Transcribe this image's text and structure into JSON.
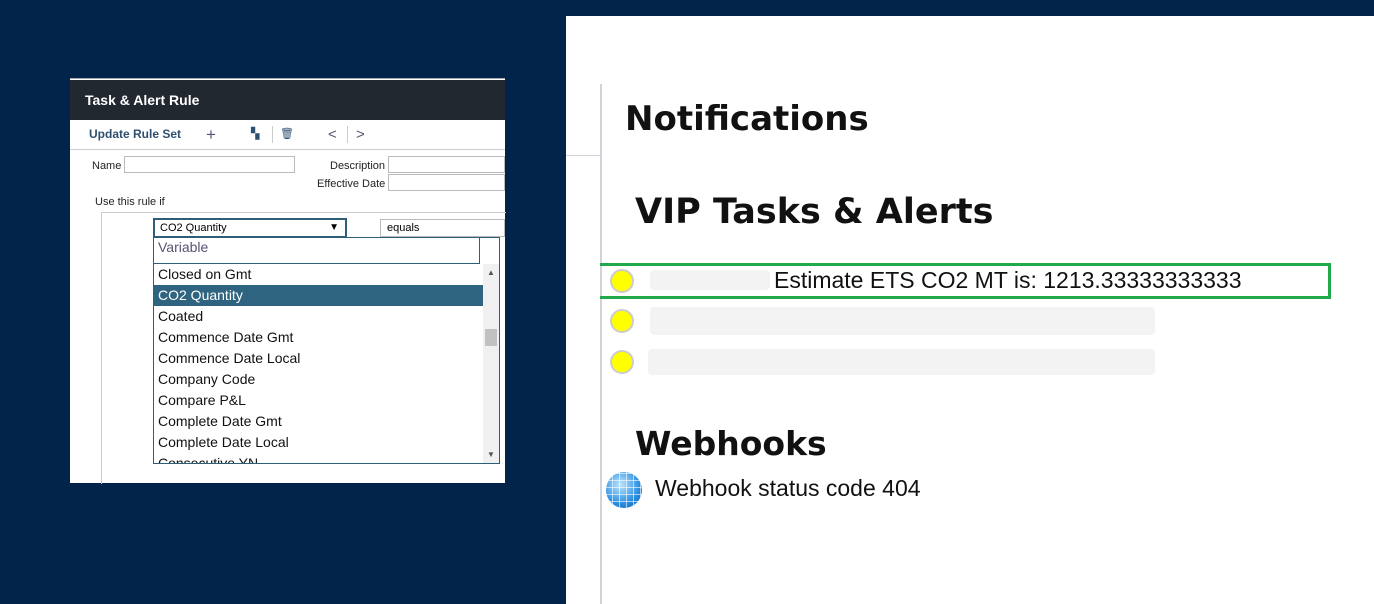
{
  "dialog": {
    "title": "Task & Alert Rule",
    "toolbar": {
      "update_label": "Update Rule Set",
      "icons": [
        "plus-icon",
        "copy-icon",
        "trash-icon",
        "chevron-left-icon",
        "chevron-right-icon"
      ]
    },
    "name_label": "Name",
    "description_label": "Description",
    "effective_date_label": "Effective Date",
    "rule_label": "Use this rule if",
    "variable_select": "CO2 Quantity",
    "operator_select": "equals",
    "search_placeholder": "Variable",
    "options": [
      "Closed on Gmt",
      "CO2 Quantity",
      "Coated",
      "Commence Date Gmt",
      "Commence Date Local",
      "Company Code",
      "Compare P&L",
      "Complete Date Gmt",
      "Complete Date Local",
      "Consecutive YN"
    ],
    "selected_option": "CO2 Quantity"
  },
  "notifications": {
    "title": "Notifications",
    "vip_title": "VIP Tasks & Alerts",
    "alerts": [
      {
        "text": "Estimate ETS CO2 MT is: 1213.33333333333",
        "status_color": "#ffff00"
      },
      {
        "text": "",
        "status_color": "#ffff00"
      },
      {
        "text": "",
        "status_color": "#ffff00"
      }
    ],
    "highlight_color": "#22aa4a",
    "webhooks_title": "Webhooks",
    "webhook_text": "Webhook status code 404"
  }
}
